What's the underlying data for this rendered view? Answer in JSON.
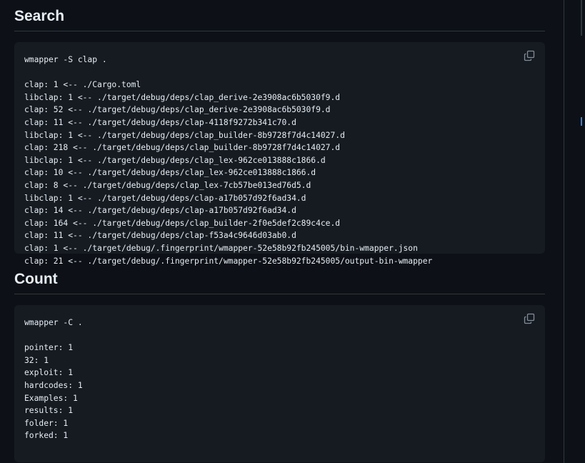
{
  "search": {
    "heading": "Search",
    "command": "wmapper -S clap .",
    "output": [
      "clap: 1 <-- ./Cargo.toml",
      "libclap: 1 <-- ./target/debug/deps/clap_derive-2e3908ac6b5030f9.d",
      "clap: 52 <-- ./target/debug/deps/clap_derive-2e3908ac6b5030f9.d",
      "clap: 11 <-- ./target/debug/deps/clap-4118f9272b341c70.d",
      "libclap: 1 <-- ./target/debug/deps/clap_builder-8b9728f7d4c14027.d",
      "clap: 218 <-- ./target/debug/deps/clap_builder-8b9728f7d4c14027.d",
      "libclap: 1 <-- ./target/debug/deps/clap_lex-962ce013888c1866.d",
      "clap: 10 <-- ./target/debug/deps/clap_lex-962ce013888c1866.d",
      "clap: 8 <-- ./target/debug/deps/clap_lex-7cb57be013ed76d5.d",
      "libclap: 1 <-- ./target/debug/deps/clap-a17b057d92f6ad34.d",
      "clap: 14 <-- ./target/debug/deps/clap-a17b057d92f6ad34.d",
      "clap: 164 <-- ./target/debug/deps/clap_builder-2f0e5def2c89c4ce.d",
      "clap: 11 <-- ./target/debug/deps/clap-f53a4c9646d03ab0.d",
      "clap: 1 <-- ./target/debug/.fingerprint/wmapper-52e58b92fb245005/bin-wmapper.json",
      "clap: 21 <-- ./target/debug/.fingerprint/wmapper-52e58b92fb245005/output-bin-wmapper"
    ]
  },
  "count": {
    "heading": "Count",
    "command": "wmapper -C .",
    "output": [
      "pointer: 1",
      "32: 1",
      "exploit: 1",
      "hardcodes: 1",
      "Examples: 1",
      "results: 1",
      "folder: 1",
      "forked: 1"
    ]
  },
  "icons": {
    "copy": "copy-icon"
  },
  "colors": {
    "background": "#0d1117",
    "code_background": "#161b22",
    "border": "#30363d",
    "text": "#e6edf3",
    "icon": "#848d97",
    "accent": "#2f81f7"
  }
}
